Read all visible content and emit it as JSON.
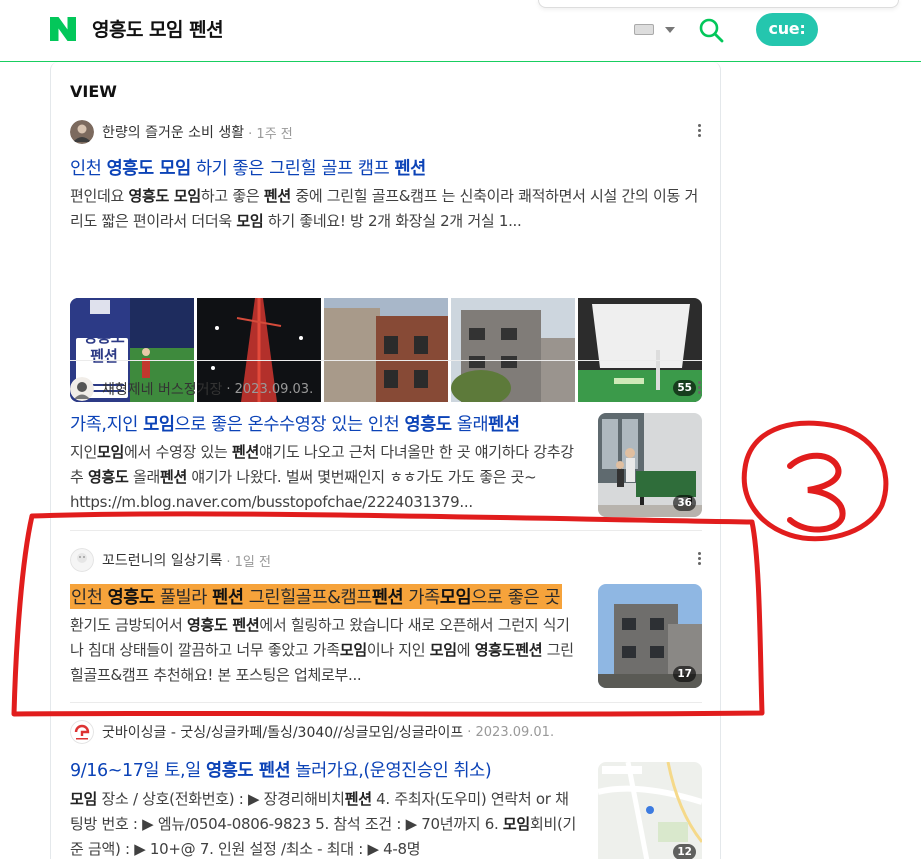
{
  "header": {
    "query": "영흥도 모임 펜션",
    "cue_label": "cue:"
  },
  "section": {
    "title": "VIEW"
  },
  "posts": [
    {
      "author": "한량의 즐거운 소비 생활",
      "date": "1주 전",
      "title": [
        {
          "t": "인천 "
        },
        {
          "t": "영흥도 모임",
          "b": true
        },
        {
          "t": " 하기 좋은 그린힐 골프 캠프 "
        },
        {
          "t": "펜션",
          "b": true
        }
      ],
      "desc": [
        {
          "t": "편인데요 "
        },
        {
          "t": "영흥도 모임",
          "b": true
        },
        {
          "t": "하고 좋은 "
        },
        {
          "t": "펜션",
          "b": true
        },
        {
          "t": " 중에 그린힐 골프&캠프 는 신축이라 쾌적하면서 시설 간의 이동 거리도 짧은 편이라서 더더욱 "
        },
        {
          "t": "모임",
          "b": true
        },
        {
          "t": " 하기 좋네요! 방 2개 화장실 2개 거실 1..."
        }
      ],
      "thumb_poster": {
        "l1": "영흥도",
        "l2": "펜션"
      },
      "thumb_count": "55"
    },
    {
      "author": "채형제네 버스정거장",
      "date": "2023.09.03.",
      "title": [
        {
          "t": "가족,지인 "
        },
        {
          "t": "모임",
          "b": true
        },
        {
          "t": "으로 좋은 온수수영장 있는 인천 "
        },
        {
          "t": "영흥도",
          "b": true
        },
        {
          "t": " 올래"
        },
        {
          "t": "펜션",
          "b": true
        }
      ],
      "desc": [
        {
          "t": "지인"
        },
        {
          "t": "모임",
          "b": true
        },
        {
          "t": "에서 수영장 있는 "
        },
        {
          "t": "펜션",
          "b": true
        },
        {
          "t": "얘기도 나오고 근처 다녀올만 한 곳 얘기하다 강추강추 "
        },
        {
          "t": "영흥도",
          "b": true
        },
        {
          "t": " 올래"
        },
        {
          "t": "펜션",
          "b": true
        },
        {
          "t": " 얘기가 나왔다. 벌써 몇번째인지 ㅎㅎ가도 가도 좋은 곳~ https://m.blog.naver.com/busstopofchae/2224031379..."
        }
      ],
      "thumb_count": "36"
    },
    {
      "author": "꼬드런니의 일상기록",
      "date": "1일 전",
      "title": [
        {
          "t": "인천 "
        },
        {
          "t": "영흥도",
          "b": true
        },
        {
          "t": " 풀빌라 "
        },
        {
          "t": "펜션",
          "b": true
        },
        {
          "t": " 그린힐골프&캠프"
        },
        {
          "t": "펜션",
          "b": true
        },
        {
          "t": " 가족"
        },
        {
          "t": "모임",
          "b": true
        },
        {
          "t": "으로 좋은 곳"
        }
      ],
      "desc": [
        {
          "t": "환기도 금방되어서 "
        },
        {
          "t": "영흥도 펜션",
          "b": true
        },
        {
          "t": "에서 힐링하고 왔습니다 새로 오픈해서 그런지 식기나 침대 상태들이 깔끔하고 너무 좋았고 가족"
        },
        {
          "t": "모임",
          "b": true
        },
        {
          "t": "이나 지인 "
        },
        {
          "t": "모임",
          "b": true
        },
        {
          "t": "에 "
        },
        {
          "t": "영흥도펜션",
          "b": true
        },
        {
          "t": " 그린힐골프&캠프 추천해요! 본 포스팅은 업체로부..."
        }
      ],
      "thumb_count": "17"
    },
    {
      "author": "굿바이싱글 - 굿싱/싱글카페/돌싱/3040//싱글모임/싱글라이프",
      "date": "2023.09.01.",
      "title": [
        {
          "t": "9/16~17일 토,일 "
        },
        {
          "t": "영흥도 펜션",
          "b": true
        },
        {
          "t": " 놀러가요,(운영진승인 취소)"
        }
      ],
      "desc": [
        {
          "t": "모임",
          "b": true
        },
        {
          "t": " 장소 / 상호(전화번호) : ▶ 장경리해비치"
        },
        {
          "t": "펜션",
          "b": true
        },
        {
          "t": " 4. 주최자(도우미) 연락처 or 채팅방 번호 : ▶ 엠뉴/0504-0806-9823 5. 참석 조건 : ▶ 70년까지 6. "
        },
        {
          "t": "모임",
          "b": true
        },
        {
          "t": "회비(기준 금액) : ▶ 10+@ 7. 인원 설정 /최소 - 최대 : ▶ 4-8명"
        }
      ],
      "thumb_count": "12"
    }
  ],
  "annotation": {
    "number": "3",
    "color": "#e11d1d"
  },
  "colors": {
    "naver_green": "#03c75a",
    "link_blue": "#0c43b7",
    "highlight_orange": "#f6a33b",
    "cue_teal": "#24c6ae"
  }
}
